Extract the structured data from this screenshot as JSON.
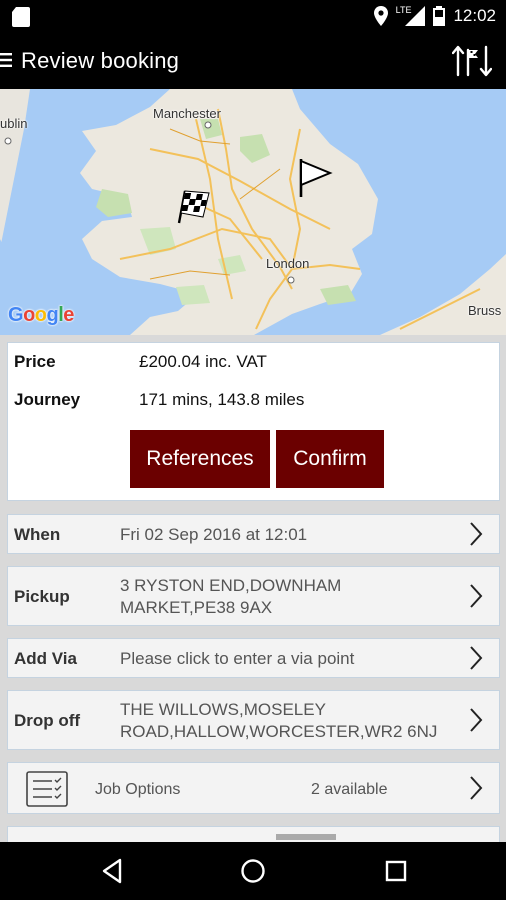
{
  "status_bar": {
    "time": "12:02",
    "network": "LTE"
  },
  "app_bar": {
    "title": "Review booking"
  },
  "map": {
    "labels": {
      "manchester": "Manchester",
      "london": "London",
      "dublin": "ublin",
      "brussels": "Bruss"
    },
    "logo": "Google"
  },
  "summary": {
    "price_label": "Price",
    "price_value": "£200.04 inc. VAT",
    "journey_label": "Journey",
    "journey_value": "171 mins, 143.8 miles",
    "references_button": "References",
    "confirm_button": "Confirm"
  },
  "rows": {
    "when": {
      "label": "When",
      "value": "Fri 02 Sep 2016 at 12:01"
    },
    "pickup": {
      "label": "Pickup",
      "value_line1": "3 RYSTON END,DOWNHAM",
      "value_line2": "MARKET,PE38 9AX"
    },
    "via": {
      "label": "Add Via",
      "value": "Please click to enter a via point"
    },
    "dropoff": {
      "label": "Drop off",
      "value_line1": "THE WILLOWS,MOSELEY",
      "value_line2": "ROAD,HALLOW,WORCESTER,WR2 6NJ"
    }
  },
  "job_options": {
    "label": "Job Options",
    "count": "2 available"
  },
  "colors": {
    "accent": "#6b0000",
    "bar": "#000000",
    "card_border": "#c5d3e0"
  }
}
